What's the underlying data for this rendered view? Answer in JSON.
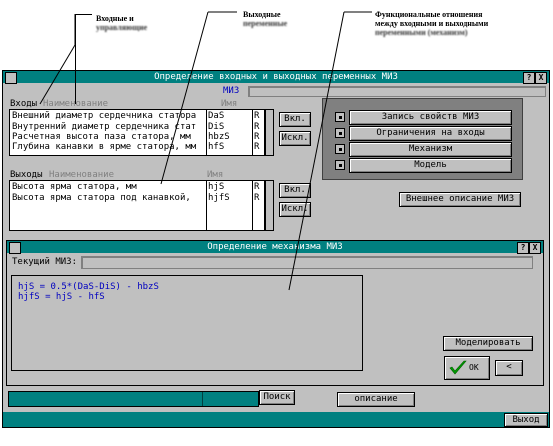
{
  "captions": {
    "inputs": [
      "Входные и",
      "управляющие"
    ],
    "outputs": [
      "Выходные",
      "переменные"
    ],
    "functional": [
      "Функциональные отношения",
      "между входными и выходными",
      "переменными (механизм)"
    ]
  },
  "main_window": {
    "title": "Определение входных и выходных переменных МИЗ",
    "help_btn": "?",
    "close_btn": "X",
    "miz_label": "МИЗ",
    "inputs_header": "Входы",
    "name_header": "Наименование",
    "id_header": "Имя",
    "inputs": [
      {
        "name": "Внешний диаметр сердечника статора",
        "id": "DaS",
        "flag": "R"
      },
      {
        "name": "Внутренний диаметр сердечника стат",
        "id": "DiS",
        "flag": "R"
      },
      {
        "name": "Расчетная высота паза статора, мм",
        "id": "hbzS",
        "flag": "R"
      },
      {
        "name": "Глубина канавки в ярме статора, мм",
        "id": "hfS",
        "flag": "R"
      }
    ],
    "outputs_header": "Выходы",
    "outputs": [
      {
        "name": "Высота ярма статора, мм",
        "id": "hjS",
        "flag": "R"
      },
      {
        "name": "Высота ярма статора под канавкой,",
        "id": "hjfS",
        "flag": "R"
      }
    ],
    "incl_label": "Вкл.",
    "excl_label": "Искл.",
    "menu": [
      "Запись свойств МИЗ",
      "Ограничения на входы",
      "Механизм",
      "Модель"
    ],
    "ext_desc_label": "Внешнее описание МИЗ",
    "search_label": "Поиск",
    "desc_label": "описание",
    "exit_label": "Выход"
  },
  "dialog": {
    "title": "Определение механизма МИЗ",
    "help_btn": "?",
    "close_btn": "X",
    "current_label": "Текущий МИЗ:",
    "formulas": [
      "hjS  = 0.5*(DaS-DiS) -  hbzS",
      "hjfS = hjS - hfS"
    ],
    "model_label": "Моделировать",
    "ok_label": "OK",
    "back_label": "<"
  },
  "colors": {
    "title_bar": "#008080",
    "desktop": "#008080",
    "panel": "#808080",
    "formula_text": "#0000c0",
    "ok_check": "#00a000"
  }
}
